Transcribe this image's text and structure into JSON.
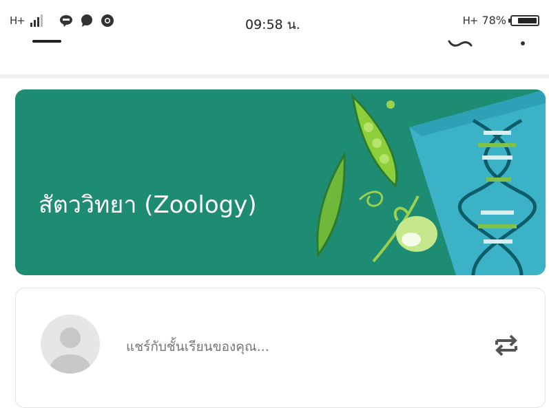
{
  "status_bar": {
    "network_left": "H+",
    "time": "09:58 น.",
    "network_right": "H+",
    "battery": "78%",
    "battery_level": 0.78,
    "notification_icons": [
      "line-icon",
      "message-bubble-icon",
      "chrome-icon"
    ]
  },
  "classroom": {
    "title": "สัตววิทยา (Zoology)",
    "banner_color": "#1e8c73"
  },
  "stream": {
    "share_placeholder": "แชร์กับชั้นเรียนของคุณ..."
  },
  "colors": {
    "accent": "#1e8c73",
    "text_muted": "#757575"
  }
}
